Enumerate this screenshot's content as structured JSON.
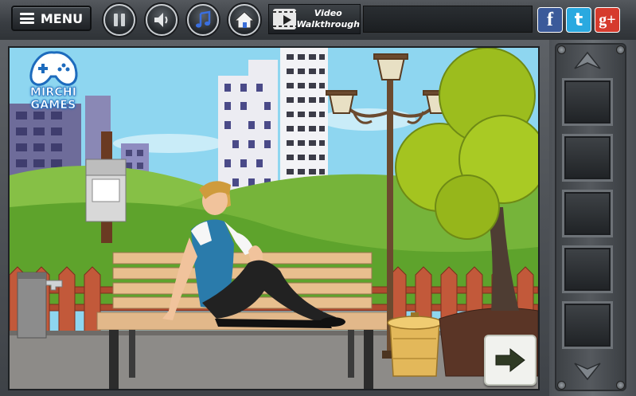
{
  "toolbar": {
    "menu_label": "MENU",
    "buttons": [
      "pause-icon",
      "speaker-icon",
      "music-note-icon",
      "home-icon"
    ],
    "video_line1": "Video",
    "video_line2": "Walkthrough"
  },
  "social": {
    "facebook": "f",
    "twitter": "t",
    "googleplus": "g+"
  },
  "logo": {
    "text": "MIRCHI GAMES"
  },
  "colors": {
    "sky": "#8fd3ee",
    "grass": "#6cae34",
    "bench_wood": "#e2b98a",
    "accent_blue": "#2f83c9"
  },
  "inventory": {
    "slot_count": 5,
    "up_arrow": "chevron-up-icon",
    "down_arrow": "chevron-down-icon"
  },
  "navigation": {
    "next_arrow": "arrow-right-icon"
  }
}
